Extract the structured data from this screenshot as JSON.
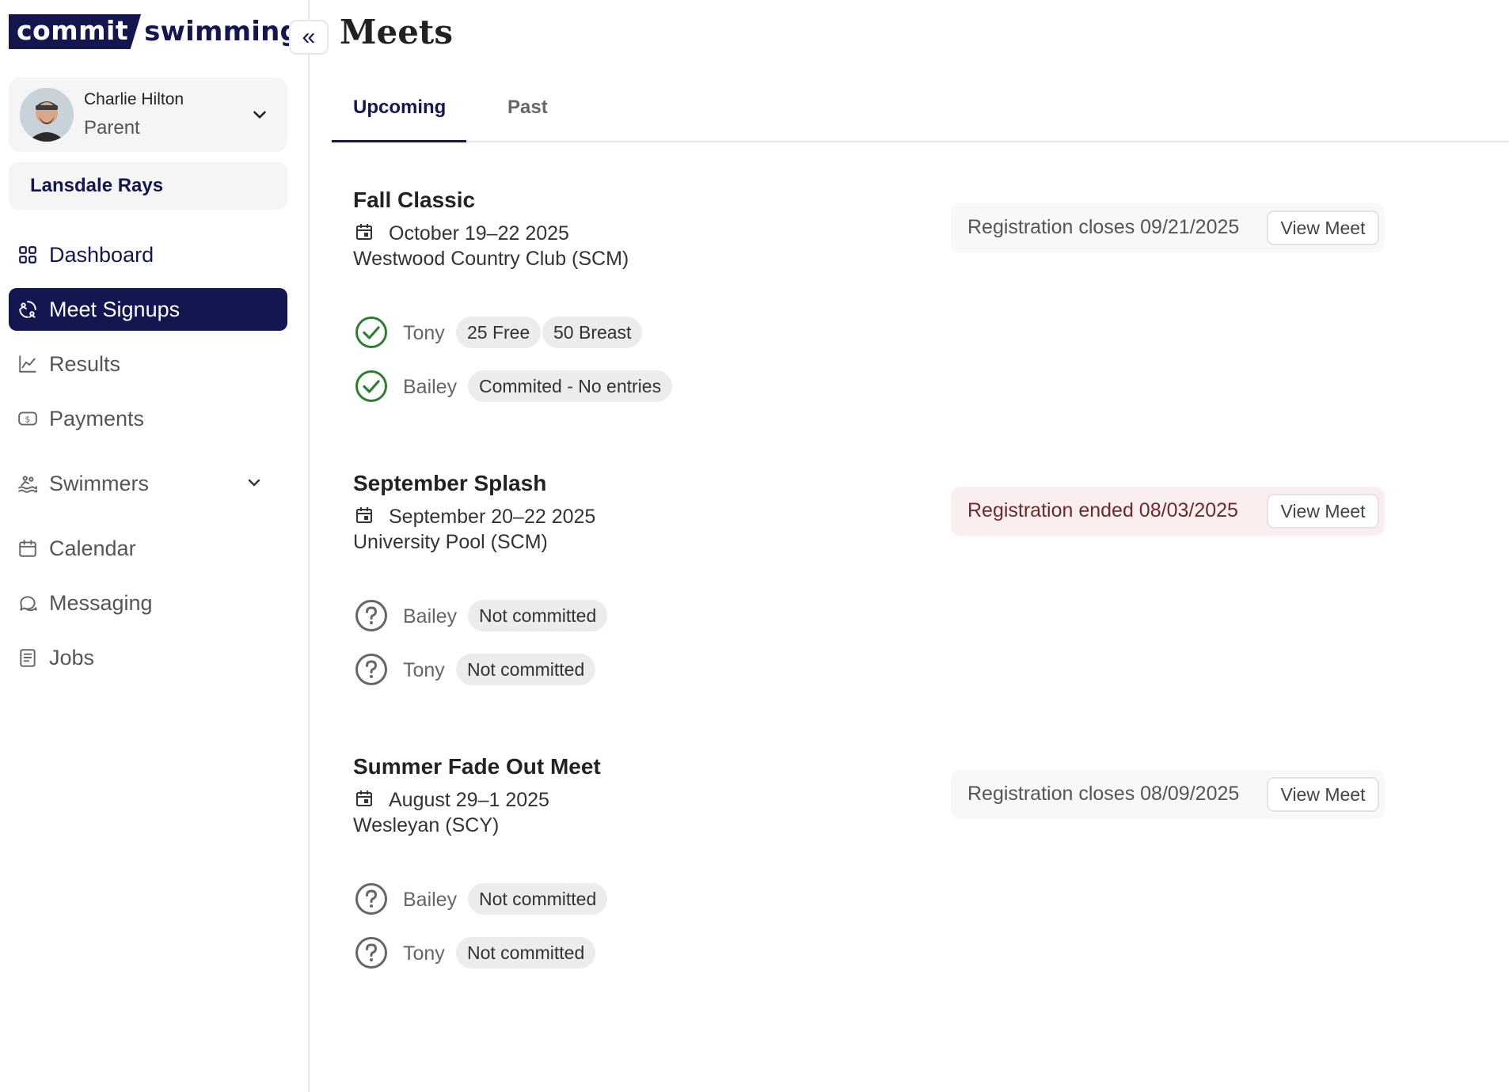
{
  "brand": {
    "part1": "commit",
    "part2": "swimming"
  },
  "profile": {
    "name": "Charlie Hilton",
    "role": "Parent"
  },
  "team": {
    "name": "Lansdale Rays"
  },
  "nav": {
    "dashboard": "Dashboard",
    "meet_signups": "Meet Signups",
    "results": "Results",
    "payments": "Payments",
    "swimmers": "Swimmers",
    "calendar": "Calendar",
    "messaging": "Messaging",
    "jobs": "Jobs"
  },
  "header": {
    "collapse": "«",
    "title": "Meets"
  },
  "tabs": {
    "upcoming": "Upcoming",
    "past": "Past",
    "active": "Upcoming"
  },
  "meets": [
    {
      "title": "Fall Classic",
      "date": "October 19–22 2025",
      "location": "Westwood Country Club (SCM)",
      "registration": "Registration closes 09/21/2025",
      "registration_status": "open",
      "view_label": "View Meet",
      "swimmers": [
        {
          "name": "Tony",
          "status": "committed",
          "chips": [
            "25 Free",
            "50 Breast"
          ]
        },
        {
          "name": "Bailey",
          "status": "committed",
          "chips": [
            "Commited - No entries"
          ]
        }
      ]
    },
    {
      "title": "September Splash",
      "date": "September 20–22 2025",
      "location": "University Pool (SCM)",
      "registration": "Registration ended 08/03/2025",
      "registration_status": "ended",
      "view_label": "View Meet",
      "swimmers": [
        {
          "name": "Bailey",
          "status": "unknown",
          "chips": [
            "Not committed"
          ]
        },
        {
          "name": "Tony",
          "status": "unknown",
          "chips": [
            "Not committed"
          ]
        }
      ]
    },
    {
      "title": "Summer Fade Out Meet",
      "date": "August 29–1 2025",
      "location": "Wesleyan (SCY)",
      "registration": "Registration closes 08/09/2025",
      "registration_status": "open",
      "view_label": "View Meet",
      "swimmers": [
        {
          "name": "Bailey",
          "status": "unknown",
          "chips": [
            "Not committed"
          ]
        },
        {
          "name": "Tony",
          "status": "unknown",
          "chips": [
            "Not committed"
          ]
        }
      ]
    }
  ],
  "colors": {
    "brand_navy": "#141650",
    "committed_green": "#2f7d32",
    "unknown_gray": "#666666",
    "ended_bg": "#fbeeee"
  }
}
